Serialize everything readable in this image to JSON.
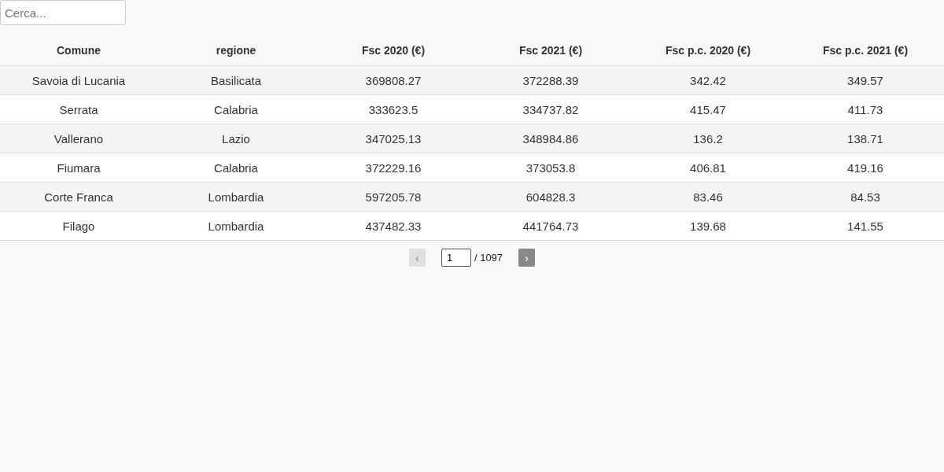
{
  "search": {
    "placeholder": "Cerca..."
  },
  "table": {
    "columns": [
      "Comune",
      "regione",
      "Fsc 2020 (€)",
      "Fsc 2021 (€)",
      "Fsc p.c. 2020 (€)",
      "Fsc p.c. 2021 (€)"
    ],
    "rows": [
      [
        "Savoia di Lucania",
        "Basilicata",
        "369808.27",
        "372288.39",
        "342.42",
        "349.57"
      ],
      [
        "Serrata",
        "Calabria",
        "333623.5",
        "334737.82",
        "415.47",
        "411.73"
      ],
      [
        "Vallerano",
        "Lazio",
        "347025.13",
        "348984.86",
        "136.2",
        "138.71"
      ],
      [
        "Fiumara",
        "Calabria",
        "372229.16",
        "373053.8",
        "406.81",
        "419.16"
      ],
      [
        "Corte Franca",
        "Lombardia",
        "597205.78",
        "604828.3",
        "83.46",
        "84.53"
      ],
      [
        "Filago",
        "Lombardia",
        "437482.33",
        "441764.73",
        "139.68",
        "141.55"
      ]
    ]
  },
  "pagination": {
    "previous": {
      "label": "‹",
      "disabled": true
    },
    "page": "1",
    "total": "/ 1097",
    "next": {
      "label": "›",
      "disabled": false
    }
  }
}
